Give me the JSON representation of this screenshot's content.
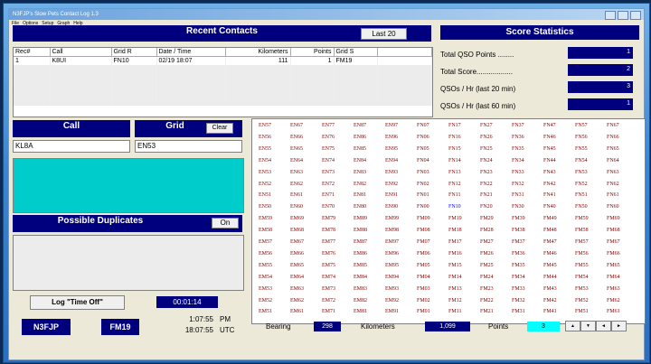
{
  "window": {
    "title": "N3FJP's Slow Pets Contact Log 1.3"
  },
  "menu": [
    "File",
    "Options",
    "Setup",
    "Graph",
    "Help"
  ],
  "recent": {
    "title": "Recent Contacts",
    "last_button": "Last 20",
    "columns": [
      "Rec#",
      "Call",
      "Grid R",
      "Date / Time",
      "Kilometers",
      "Points",
      "Grid S"
    ],
    "rows": [
      [
        "1",
        "K8UI",
        "FN10",
        "02/19  18:07",
        "111",
        "1",
        "FM19"
      ]
    ]
  },
  "score": {
    "title": "Score Statistics",
    "items": [
      {
        "label": "Total QSO Points ........",
        "value": "1"
      },
      {
        "label": "Total Score..................",
        "value": "2"
      },
      {
        "label": "QSOs / Hr (last 20 min)",
        "value": "3"
      },
      {
        "label": "QSOs / Hr (last 60 min)",
        "value": "1"
      }
    ]
  },
  "entry": {
    "call_header": "Call",
    "grid_header": "Grid",
    "clear_button": "Clear",
    "call_value": "KL8A",
    "grid_value": "EN53"
  },
  "dupes": {
    "title": "Possible Duplicates",
    "toggle": "On"
  },
  "timer": {
    "log_time_off": "Log \"Time Off\"",
    "elapsed": "00:01:14"
  },
  "station": {
    "call": "N3FJP",
    "grid": "FM19",
    "local_time": "1:07:55",
    "local_suffix": "PM",
    "utc_time": "18:07:55",
    "utc_suffix": "UTC"
  },
  "bottom": {
    "bearing_label": "Bearing",
    "bearing_value": "298",
    "km_label": "Kilometers",
    "km_value": "1,099",
    "points_label": "Points",
    "points_value": "3",
    "arrows": [
      "▲",
      "▼",
      "◄",
      "►"
    ]
  },
  "grid_squares": {
    "columns": [
      "EN5",
      "EN6",
      "EN7",
      "EN8",
      "EN9",
      "FN0",
      "FN1",
      "FN2",
      "FN3",
      "FN4",
      "FN5",
      "FN6",
      "EM5",
      "EM6",
      "EM7",
      "EM8",
      "EM9",
      "FM0",
      "FM1",
      "FM2",
      "FM3",
      "FM4",
      "FM5",
      "FM6"
    ],
    "highlight": "FN10",
    "rows": [
      [
        "EN57",
        "EN67",
        "EN77",
        "EN87",
        "EN97",
        "FN07",
        "FN17",
        "FN27",
        "FN37",
        "FN47",
        "FN57",
        "FN67"
      ],
      [
        "EN56",
        "EN66",
        "EN76",
        "EN86",
        "EN96",
        "FN06",
        "FN16",
        "FN26",
        "FN36",
        "FN46",
        "FN56",
        "FN66"
      ],
      [
        "EN55",
        "EN65",
        "EN75",
        "EN85",
        "EN95",
        "FN05",
        "FN15",
        "FN25",
        "FN35",
        "FN45",
        "FN55",
        "FN65"
      ],
      [
        "EN54",
        "EN64",
        "EN74",
        "EN84",
        "EN94",
        "FN04",
        "FN14",
        "FN24",
        "FN34",
        "FN44",
        "FN54",
        "FN64"
      ],
      [
        "EN53",
        "EN63",
        "EN73",
        "EN83",
        "EN93",
        "FN03",
        "FN13",
        "FN23",
        "FN33",
        "FN43",
        "FN53",
        "FN63"
      ],
      [
        "EN52",
        "EN62",
        "EN72",
        "EN82",
        "EN92",
        "FN02",
        "FN12",
        "FN22",
        "FN32",
        "FN42",
        "FN52",
        "FN62"
      ],
      [
        "EN51",
        "EN61",
        "EN71",
        "EN81",
        "EN91",
        "FN01",
        "FN11",
        "FN21",
        "FN31",
        "FN41",
        "FN51",
        "FN61"
      ],
      [
        "EN50",
        "EN60",
        "EN70",
        "EN80",
        "EN90",
        "FN00",
        "FN10",
        "FN20",
        "FN30",
        "FN40",
        "FN50",
        "FN60"
      ],
      [
        "EM59",
        "EM69",
        "EM79",
        "EM89",
        "EM99",
        "FM09",
        "FM19",
        "FM29",
        "FM39",
        "FM49",
        "FM59",
        "FM69"
      ],
      [
        "EM58",
        "EM68",
        "EM78",
        "EM88",
        "EM98",
        "FM08",
        "FM18",
        "FM28",
        "FM38",
        "FM48",
        "FM58",
        "FM68"
      ],
      [
        "EM57",
        "EM67",
        "EM77",
        "EM87",
        "EM97",
        "FM07",
        "FM17",
        "FM27",
        "FM37",
        "FM47",
        "FM57",
        "FM67"
      ],
      [
        "EM56",
        "EM66",
        "EM76",
        "EM86",
        "EM96",
        "FM06",
        "FM16",
        "FM26",
        "FM36",
        "FM46",
        "FM56",
        "FM66"
      ],
      [
        "EM55",
        "EM65",
        "EM75",
        "EM85",
        "EM95",
        "FM05",
        "FM15",
        "FM25",
        "FM35",
        "FM45",
        "FM55",
        "FM65"
      ],
      [
        "EM54",
        "EM64",
        "EM74",
        "EM84",
        "EM94",
        "FM04",
        "FM14",
        "FM24",
        "FM34",
        "FM44",
        "FM54",
        "FM64"
      ],
      [
        "EM53",
        "EM63",
        "EM73",
        "EM83",
        "EM93",
        "FM03",
        "FM13",
        "FM23",
        "FM33",
        "FM43",
        "FM53",
        "FM63"
      ],
      [
        "EM52",
        "EM62",
        "EM72",
        "EM82",
        "EM92",
        "FM02",
        "FM12",
        "FM22",
        "FM32",
        "FM42",
        "FM52",
        "FM62"
      ],
      [
        "EM51",
        "EM61",
        "EM71",
        "EM81",
        "EM91",
        "FM01",
        "FM11",
        "FM21",
        "FM31",
        "FM41",
        "FM51",
        "FM61"
      ]
    ]
  },
  "colors": {
    "header_bg": "#00007f",
    "entry_cyan": "#00cccc",
    "points_cyan": "#00ffff",
    "grid_text": "#800000",
    "grid_highlight": "#0000ff"
  }
}
